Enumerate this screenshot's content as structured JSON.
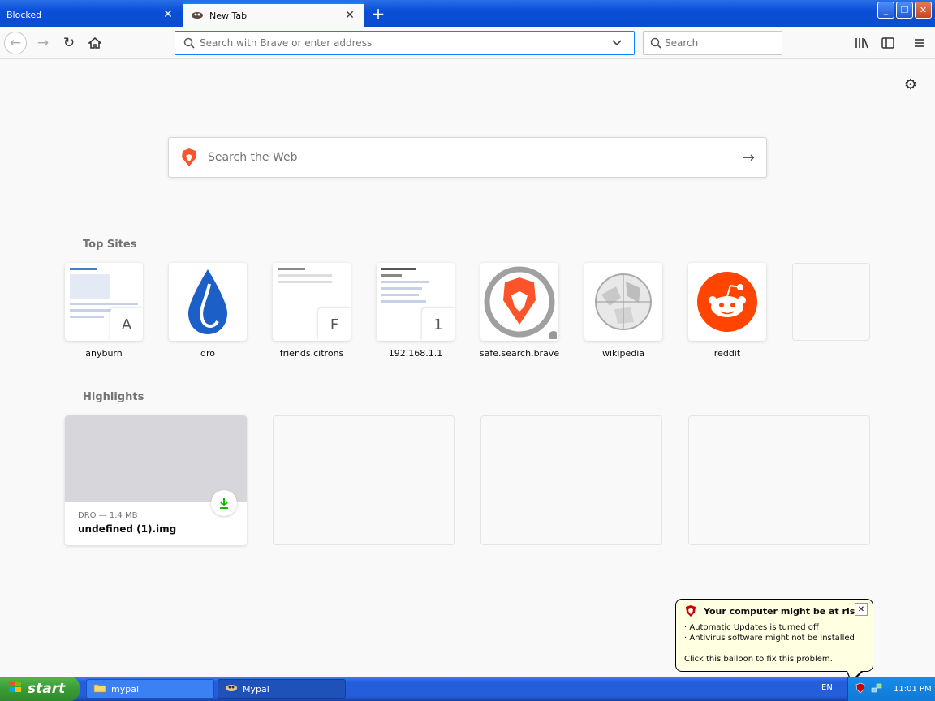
{
  "tabs": [
    {
      "label": "Blocked",
      "active": false
    },
    {
      "label": "New Tab",
      "active": true
    }
  ],
  "navbar": {
    "url_placeholder": "Search with Brave or enter address",
    "search_placeholder": "Search"
  },
  "content": {
    "web_search_placeholder": "Search the Web",
    "top_sites_title": "Top Sites",
    "highlights_title": "Highlights",
    "top_sites": [
      {
        "label": "anyburn",
        "letter": "A"
      },
      {
        "label": "dro",
        "letter": ""
      },
      {
        "label": "friends.citrons",
        "letter": "F"
      },
      {
        "label": "192.168.1.1",
        "letter": "1"
      },
      {
        "label": "safe.search.brave",
        "letter": ""
      },
      {
        "label": "wikipedia",
        "letter": ""
      },
      {
        "label": "reddit",
        "letter": ""
      }
    ],
    "highlight": {
      "meta": "DRO — 1.4 MB",
      "title": "undefined (1).img"
    }
  },
  "balloon": {
    "title": "Your computer might be at risk",
    "line1": "· Automatic Updates is turned off",
    "line2": "· Antivirus software might not be installed",
    "footer": "Click this balloon to fix this problem."
  },
  "taskbar": {
    "start_label": "start",
    "tasks": [
      {
        "label": "mypal"
      },
      {
        "label": "Mypal"
      }
    ],
    "language": "EN",
    "clock": "11:01 PM"
  },
  "colors": {
    "accent": "#0a84ff",
    "brave": "#fb542b",
    "reddit": "#ff4500",
    "download": "#12bc00"
  }
}
